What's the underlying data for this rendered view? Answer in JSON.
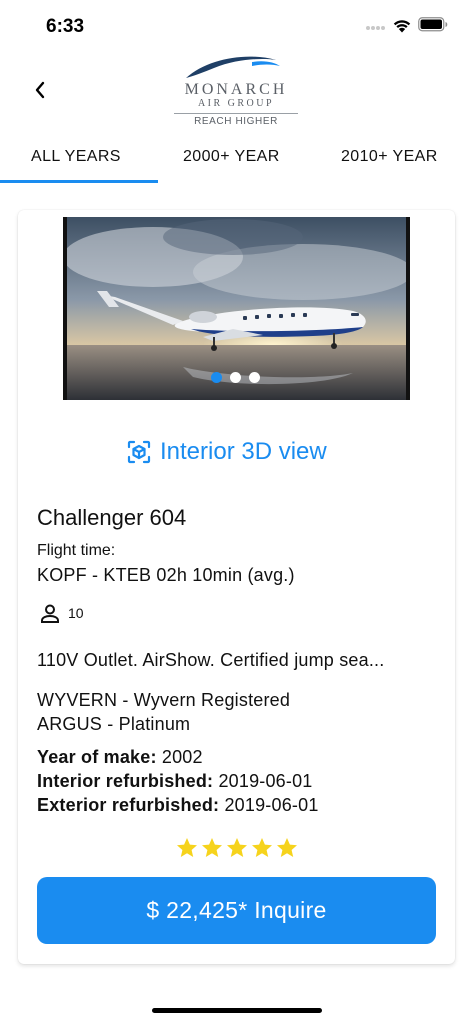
{
  "status_bar": {
    "time": "6:33"
  },
  "header": {
    "back_icon": "chevron-left-icon",
    "logo": {
      "name": "MONARCH",
      "sub": "AIR GROUP",
      "tagline": "REACH HIGHER"
    }
  },
  "tabs": [
    {
      "label": "ALL YEARS",
      "active": true
    },
    {
      "label": "2000+ YEAR",
      "active": false
    },
    {
      "label": "2010+ YEAR",
      "active": false
    }
  ],
  "listing": {
    "carousel": {
      "count": 3,
      "active_index": 0
    },
    "interior_link": {
      "icon": "3d-cube-icon",
      "label": "Interior 3D view"
    },
    "aircraft": "Challenger 604",
    "flight_time_label": "Flight time:",
    "flight_route": "KOPF - KTEB 02h 10min (avg.)",
    "passengers": "10",
    "amenities": "110V Outlet. AirShow. Certified jump sea...",
    "certifications": [
      "WYVERN - Wyvern Registered",
      "ARGUS - Platinum"
    ],
    "specs": {
      "year_label": "Year of make:",
      "year_value": "2002",
      "interior_label": "Interior refurbished:",
      "interior_value": "2019-06-01",
      "exterior_label": "Exterior refurbished:",
      "exterior_value": "2019-06-01"
    },
    "rating": 5,
    "inquire_label": "$ 22,425* Inquire"
  },
  "colors": {
    "accent": "#1a8cf0",
    "star": "#f6d31c",
    "text": "#111111"
  }
}
